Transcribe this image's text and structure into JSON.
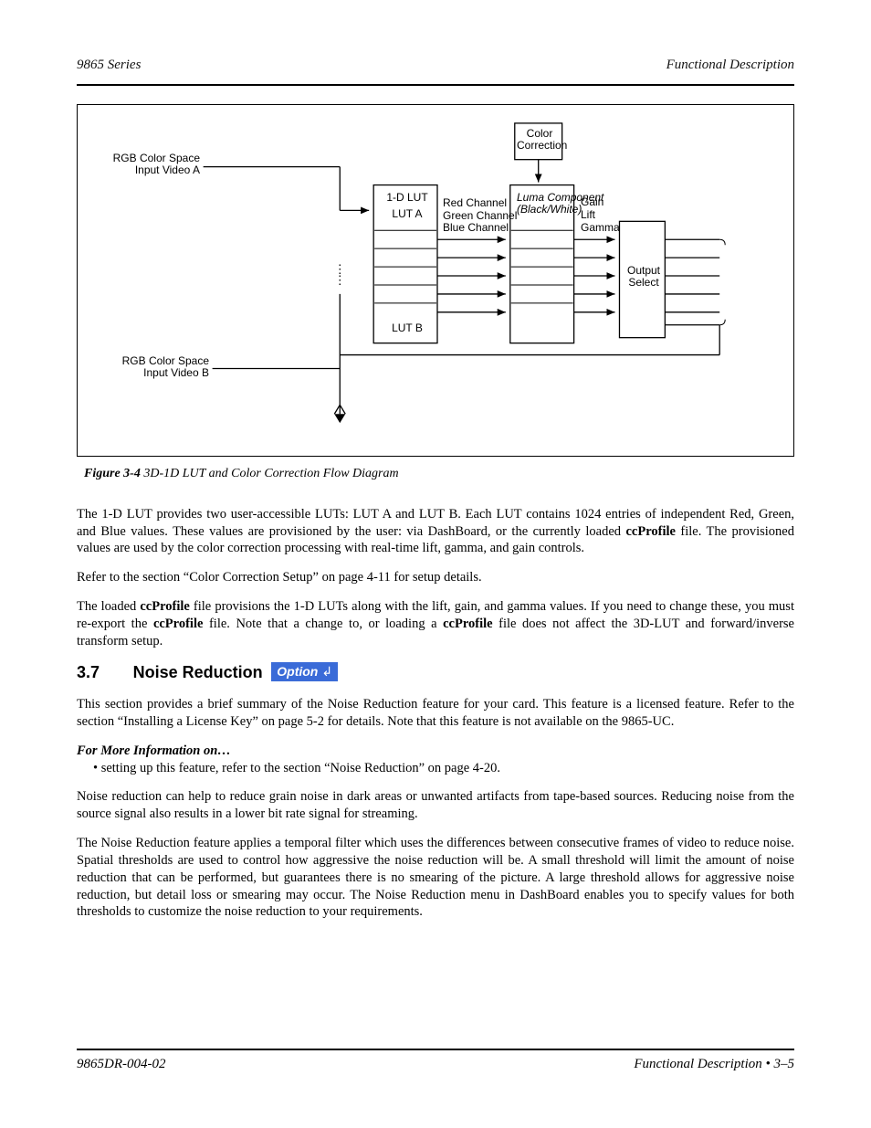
{
  "header": {
    "left": "9865 Series",
    "right": "Functional Description"
  },
  "diagram": {
    "lines": {
      "l1": "RGB Color Space\nInput Video A",
      "l2": "RGB Color Space\nInput Video B",
      "l3": "Color\nCorrection",
      "lut_title": "1-D LUT",
      "lut_a": "LUT A",
      "lut_b": "LUT B",
      "cc_r": "Red Channel",
      "cc_g": "Green Channel",
      "cc_b": "Blue Channel",
      "cc_lum": "Luma Component\n(Black/White)",
      "cc_gamma": "Gamma",
      "cc_lift": "Lift",
      "cc_gain": "Gain",
      "out": "Output\nSelect"
    }
  },
  "caption": {
    "label": "Figure 3-4",
    "text": " 3D-1D LUT and Color Correction Flow Diagram"
  },
  "paragraphs": {
    "p1a": "The 1-D LUT provides two user-accessible LUTs: LUT A and LUT B. Each LUT contains 1024 entries of independent Red, Green, and Blue values. These values are provisioned by the user: via DashBoard, or the currently loaded ",
    "p1b": "ccProfile",
    "p1c": " file. The provisioned values are used by the color correction processing with real-time lift, gamma, and gain controls.",
    "p2": "Refer to the section “Color Correction Setup” on page 4-11 for setup details.",
    "p3a": "The loaded ",
    "p3b": "ccProfile",
    "p3c": " file provisions the 1-D LUTs along with the lift, gain, and gamma values. If you need to change these, you must re-export the ",
    "p3d": "ccProfile",
    "p3e": " file. Note that a change to, or loading a ",
    "p3f": "ccProfile",
    "p3g": " file does not affect the 3D-LUT and forward/inverse transform setup."
  },
  "section": {
    "num": "3.7",
    "title": "Noise Reduction",
    "option_label": "Option",
    "option_arrow": "↲"
  },
  "sec_paras": {
    "s1": "This section provides a brief summary of the Noise Reduction feature for your card. This feature is a licensed feature. Refer to the section “Installing a License Key” on page 5-2 for details. Note that this feature is not available on the 9865-UC.",
    "em": "For More Information on…",
    "li": "• setting up this feature, refer to the section “Noise Reduction” on page 4-20.",
    "s3": "Noise reduction can help to reduce grain noise in dark areas or unwanted artifacts from tape-based sources. Reducing noise from the source signal also results in a lower bit rate signal for streaming.",
    "s4": "The Noise Reduction feature applies a temporal filter which uses the differences between consecutive frames of video to reduce noise. Spatial thresholds are used to control how aggressive the noise reduction will be. A small threshold will limit the amount of noise reduction that can be performed, but guarantees there is no smearing of the picture. A large threshold allows for aggressive noise reduction, but detail loss or smearing may occur. The Noise Reduction menu in DashBoard enables you to specify values for both thresholds to customize the noise reduction to your requirements."
  },
  "footer": {
    "left": "9865DR-004-02",
    "right": "Functional Description   •   3–5"
  }
}
